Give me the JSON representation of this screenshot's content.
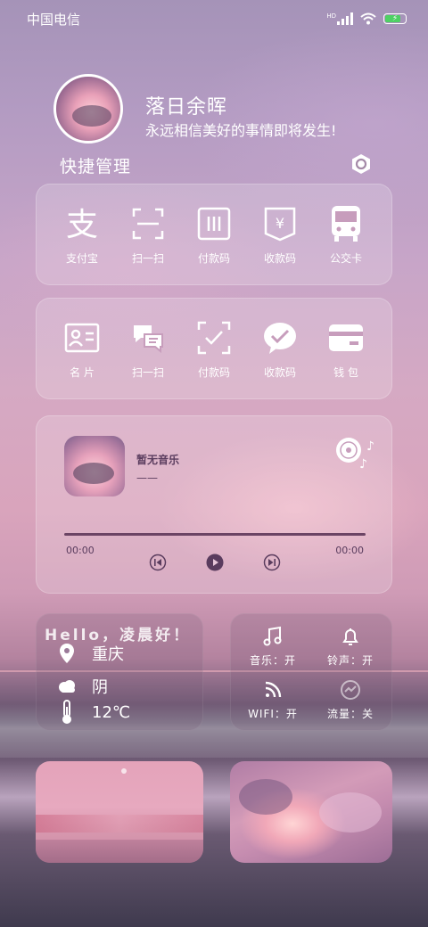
{
  "status_bar": {
    "carrier": "中国电信",
    "network": "HD"
  },
  "profile": {
    "name": "落日余晖",
    "motto": "永远相信美好的事情即将发生!"
  },
  "quick_manage": {
    "title": "快捷管理"
  },
  "row1": [
    {
      "label": "支付宝",
      "icon": "alipay-icon"
    },
    {
      "label": "扫一扫",
      "icon": "scan-icon"
    },
    {
      "label": "付款码",
      "icon": "payment-code-icon"
    },
    {
      "label": "收款码",
      "icon": "receive-code-icon"
    },
    {
      "label": "公交卡",
      "icon": "bus-card-icon"
    }
  ],
  "row2": [
    {
      "label": "名 片",
      "icon": "business-card-icon"
    },
    {
      "label": "扫一扫",
      "icon": "wechat-scan-icon"
    },
    {
      "label": "付款码",
      "icon": "wechat-payment-icon"
    },
    {
      "label": "收款码",
      "icon": "wechat-icon"
    },
    {
      "label": "钱 包",
      "icon": "wallet-icon"
    }
  ],
  "music": {
    "title": "暂无音乐",
    "artist": "——",
    "current_time": "00:00",
    "total_time": "00:00",
    "progress": 0
  },
  "weather": {
    "greeting": "Hello，凌晨好！",
    "city": "重庆",
    "condition": "阴",
    "temperature": "12℃"
  },
  "toggles": [
    {
      "label": "音乐：开",
      "icon": "music-note-icon"
    },
    {
      "label": "铃声：开",
      "icon": "bell-icon"
    },
    {
      "label": "WIFI：开",
      "icon": "wifi-icon"
    },
    {
      "label": "流量：关",
      "icon": "data-usage-icon"
    }
  ],
  "colors": {
    "battery": "#4ed164",
    "dark_text": "#5a3c5e",
    "progress": "#6b4464"
  }
}
